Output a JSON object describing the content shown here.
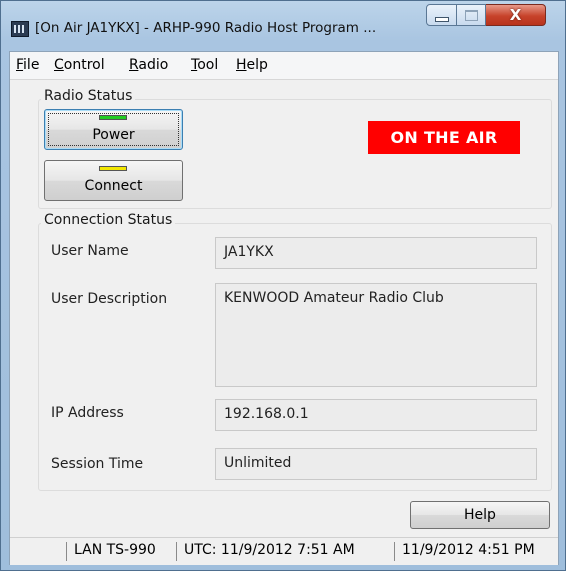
{
  "window": {
    "title": "[On Air JA1YKX] - ARHP-990 Radio Host Program ...",
    "close_glyph": "X"
  },
  "menu": {
    "items": [
      "File",
      "Control",
      "Radio",
      "Tool",
      "Help"
    ]
  },
  "radio_status": {
    "group_label": "Radio Status",
    "power_label": "Power",
    "power_led_color": "#22cc22",
    "connect_label": "Connect",
    "connect_led_color": "#f2e600",
    "on_air_text": "ON THE AIR",
    "on_air_color": "#ff0000"
  },
  "connection_status": {
    "group_label": "Connection Status",
    "fields": {
      "user_name": {
        "label": "User Name",
        "value": "JA1YKX"
      },
      "user_description": {
        "label": "User Description",
        "value": "KENWOOD Amateur Radio Club"
      },
      "ip_address": {
        "label": "IP Address",
        "value": "192.168.0.1"
      },
      "session_time": {
        "label": "Session Time",
        "value": "Unlimited"
      }
    }
  },
  "footer": {
    "help_label": "Help"
  },
  "statusbar": {
    "radio": "LAN TS-990",
    "utc": "UTC: 11/9/2012 7:51 AM",
    "local": "11/9/2012 4:51 PM"
  }
}
